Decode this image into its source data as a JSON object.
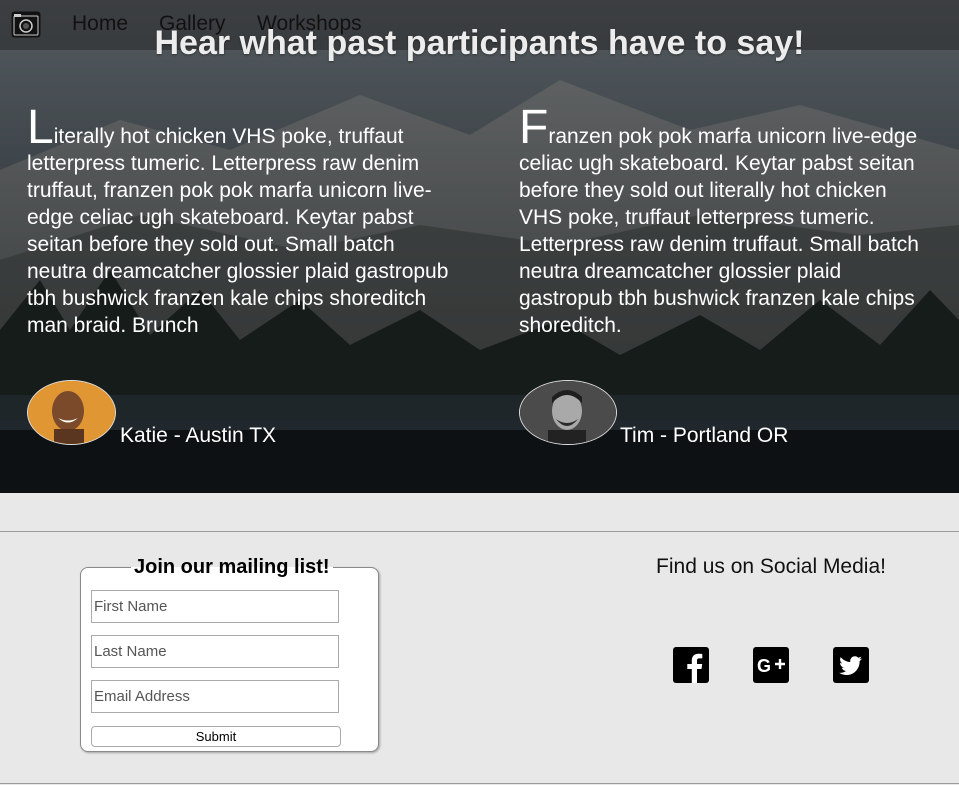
{
  "nav": {
    "logo": "camera-icon",
    "links": [
      "Home",
      "Gallery",
      "Workshops"
    ]
  },
  "hero": {
    "title": "Hear what past participants have to say!",
    "testimonials": [
      {
        "initial": "L",
        "text": "iterally hot chicken VHS poke, truffaut letterpress tumeric. Letterpress raw denim truffaut, franzen pok pok marfa unicorn live-edge celiac ugh skateboard. Keytar pabst seitan before they sold out. Small batch neutra dreamcatcher glossier plaid gastropub tbh bushwick franzen kale chips shoreditch man braid. Brunch",
        "author": "Katie - Austin TX"
      },
      {
        "initial": "F",
        "text": "ranzen pok pok marfa unicorn live-edge celiac ugh skateboard. Keytar pabst seitan before they sold out literally hot chicken VHS poke, truffaut letterpress tumeric. Letterpress raw denim truffaut. Small batch neutra dreamcatcher glossier plaid gastropub tbh bushwick franzen kale chips shoreditch.",
        "author": "Tim - Portland OR"
      }
    ]
  },
  "mailing": {
    "legend": "Join our mailing list!",
    "first_name_placeholder": "First Name",
    "last_name_placeholder": "Last Name",
    "email_placeholder": "Email Address",
    "submit_label": "Submit"
  },
  "social": {
    "title": "Find us on Social Media!",
    "icons": [
      "facebook-icon",
      "google-plus-icon",
      "twitter-icon"
    ]
  }
}
